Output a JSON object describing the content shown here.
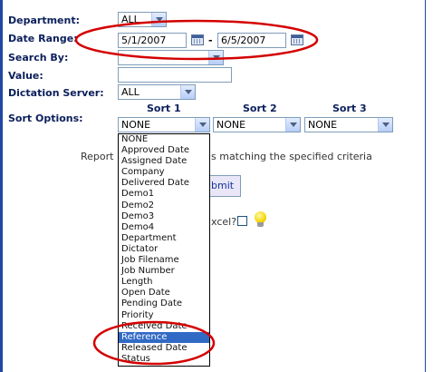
{
  "form": {
    "department_label": "Department:",
    "department_value": "ALL",
    "date_range_label": "Date Range:",
    "date_from": "5/1/2007",
    "date_to": "6/5/2007",
    "date_separator": "-",
    "search_by_label": "Search By:",
    "search_by_value": "",
    "value_label": "Value:",
    "value_input": "",
    "dictation_server_label": "Dictation Server:",
    "dictation_server_value": "ALL",
    "sort_options_label": "Sort Options:",
    "sort1_header": "Sort 1",
    "sort2_header": "Sort 2",
    "sort3_header": "Sort 3",
    "sort1_value": "NONE",
    "sort2_value": "NONE",
    "sort3_value": "NONE",
    "report_text_left": "Report is",
    "report_text_right": "s matching the specified criteria",
    "submit_label": "bmit",
    "excel_label": "xcel?"
  },
  "dropdown": {
    "options": [
      "NONE",
      "Approved Date",
      "Assigned Date",
      "Company",
      "Delivered Date",
      "Demo1",
      "Demo2",
      "Demo3",
      "Demo4",
      "Department",
      "Dictator",
      "Job Filename",
      "Job Number",
      "Length",
      "Open Date",
      "Pending Date",
      "Priority",
      "Received Date",
      "Reference",
      "Released Date",
      "Status"
    ],
    "highlighted": "Reference"
  },
  "colors": {
    "label_color": "#0b1f5c",
    "highlight": "#316ac5",
    "annotation": "#d40000",
    "border_accent": "#1f47a3"
  },
  "icons": [
    "calendar-icon",
    "calendar-icon",
    "lightbulb-icon"
  ]
}
